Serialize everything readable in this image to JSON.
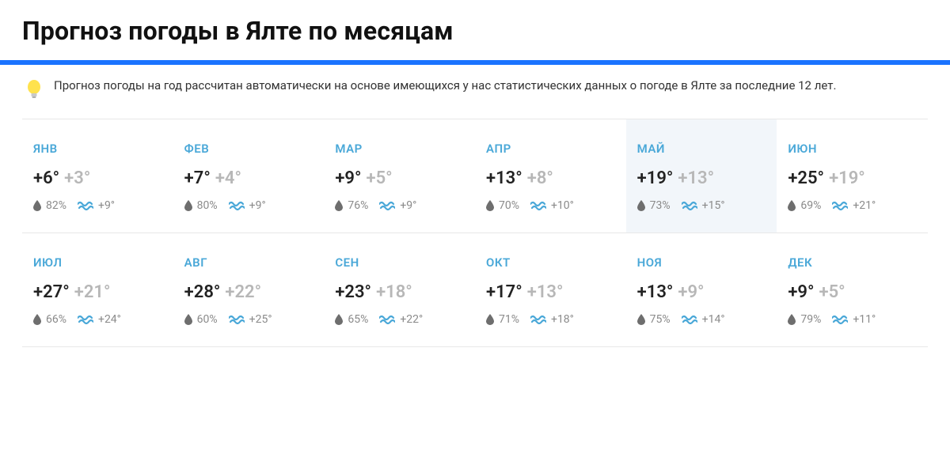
{
  "title": "Прогноз погоды в Ялте по месяцам",
  "notice": "Прогноз погоды на год рассчитан автоматически на основе имеющихся у нас статистических данных о погоде в Ялте за последние 12 лет.",
  "highlight_index": 4,
  "months": [
    {
      "label": "ЯНВ",
      "hi": "+6°",
      "lo": "+3°",
      "humidity": "82%",
      "water": "+9°"
    },
    {
      "label": "ФЕВ",
      "hi": "+7°",
      "lo": "+4°",
      "humidity": "80%",
      "water": "+9°"
    },
    {
      "label": "МАР",
      "hi": "+9°",
      "lo": "+5°",
      "humidity": "76%",
      "water": "+9°"
    },
    {
      "label": "АПР",
      "hi": "+13°",
      "lo": "+8°",
      "humidity": "70%",
      "water": "+10°"
    },
    {
      "label": "МАЙ",
      "hi": "+19°",
      "lo": "+13°",
      "humidity": "73%",
      "water": "+15°"
    },
    {
      "label": "ИЮН",
      "hi": "+25°",
      "lo": "+19°",
      "humidity": "69%",
      "water": "+21°"
    },
    {
      "label": "ИЮЛ",
      "hi": "+27°",
      "lo": "+21°",
      "humidity": "66%",
      "water": "+24°"
    },
    {
      "label": "АВГ",
      "hi": "+28°",
      "lo": "+22°",
      "humidity": "60%",
      "water": "+25°"
    },
    {
      "label": "СЕН",
      "hi": "+23°",
      "lo": "+18°",
      "humidity": "65%",
      "water": "+22°"
    },
    {
      "label": "ОКТ",
      "hi": "+17°",
      "lo": "+13°",
      "humidity": "71%",
      "water": "+18°"
    },
    {
      "label": "НОЯ",
      "hi": "+13°",
      "lo": "+9°",
      "humidity": "75%",
      "water": "+14°"
    },
    {
      "label": "ДЕК",
      "hi": "+9°",
      "lo": "+5°",
      "humidity": "79%",
      "water": "+11°"
    }
  ]
}
